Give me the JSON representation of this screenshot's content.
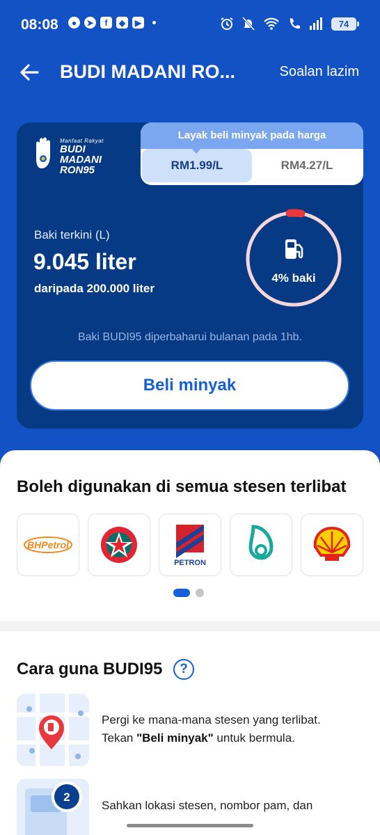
{
  "status_bar": {
    "time": "08:08",
    "battery": "74",
    "notification_icons": [
      "chat-icon",
      "telegram-icon",
      "facebook-icon",
      "app-icon",
      "youtube-icon"
    ],
    "system_icons": [
      "alarm-icon",
      "mute-icon",
      "wifi-icon",
      "call-icon",
      "signal-icon",
      "battery-icon"
    ]
  },
  "header": {
    "title": "BUDI MADANI RO...",
    "faq": "Soalan lazim"
  },
  "logo": {
    "small": "Manfaat Rakyat",
    "line1": "BUDI",
    "line2": "MADANI",
    "line3": "RON95"
  },
  "price_panel": {
    "heading": "Layak beli minyak pada harga",
    "selected": "RM1.99/L",
    "other": "RM4.27/L"
  },
  "balance": {
    "label": "Baki terkini (L)",
    "value": "9.045 liter",
    "total": "daripada 200.000 liter",
    "percent_text": "4% baki",
    "percent": 4
  },
  "reset_note": "Baki BUDI95 diperbaharui bulanan pada 1hb.",
  "buy_button": "Beli minyak",
  "stations": {
    "title": "Boleh digunakan di semua stesen terlibat",
    "items": [
      "BHPetrol",
      "Caltex",
      "Petron",
      "Petronas",
      "Shell"
    ],
    "bhp_text": "BHPetrol",
    "petron_text": "PETRON"
  },
  "howto": {
    "title": "Cara guna BUDI95",
    "help": "?",
    "step1_a": "Pergi ke mana-mana stesen yang terlibat.",
    "step1_b": "Tekan ",
    "step1_bold": "\"Beli minyak\"",
    "step1_c": " untuk bermula.",
    "step2": "Sahkan lokasi stesen, nombor pam, dan",
    "step2_badge": "2"
  },
  "colors": {
    "primary": "#1252c4",
    "card": "#073a84",
    "accent": "#1560d8",
    "gauge_track": "#f6d6d8",
    "gauge_fill": "#e8383d"
  }
}
